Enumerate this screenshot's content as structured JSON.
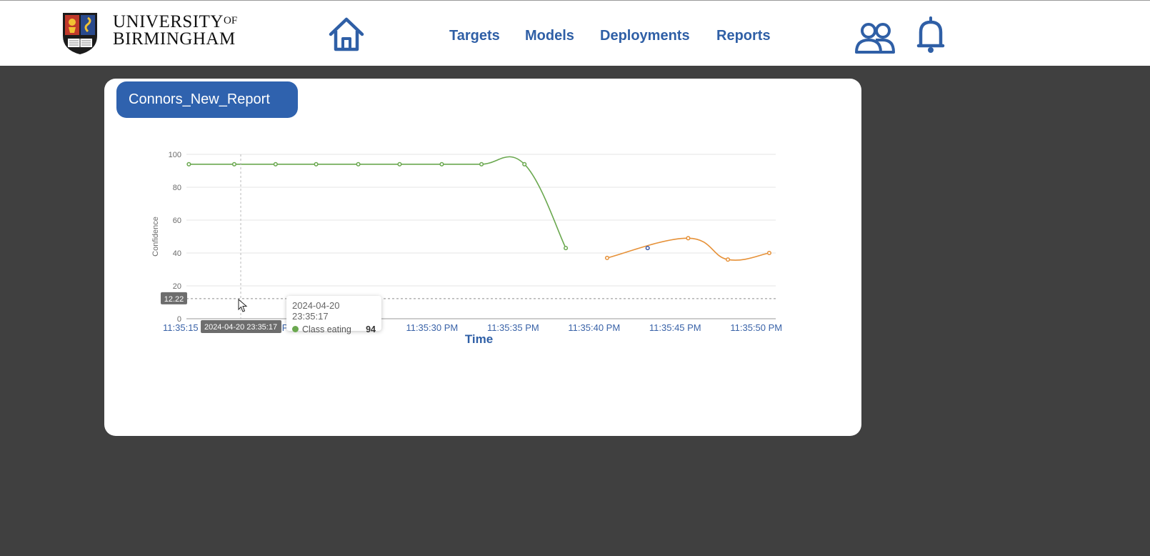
{
  "header": {
    "logo": {
      "line1": "UNIVERSITY",
      "of": "OF",
      "line2": "BIRMINGHAM"
    },
    "home_icon": "home-icon",
    "nav": [
      "Targets",
      "Models",
      "Deployments",
      "Reports"
    ],
    "users_icon": "users-icon",
    "bell_icon": "bell-icon",
    "accent_color": "#2f5fa6"
  },
  "report": {
    "title": "Connors_New_Report"
  },
  "chart_data": {
    "type": "line",
    "ylabel": "Confidence",
    "xlabel": "Time",
    "ylim": [
      0,
      100
    ],
    "y_ticks": [
      "0",
      "20",
      "40",
      "60",
      "80",
      "100"
    ],
    "x_ticks": [
      "11:35:15 PM",
      "11:35:20 PM",
      "11:35:25 PM",
      "11:35:30 PM",
      "11:35:35 PM",
      "11:35:40 PM",
      "11:35:45 PM",
      "11:35:50 PM"
    ],
    "x_tick_values": [
      15,
      20,
      25,
      30,
      35,
      40,
      45,
      50
    ],
    "series": [
      {
        "name": "Class eating",
        "color": "#6aa84f",
        "x": [
          15.0,
          17.8,
          20.35,
          22.85,
          25.45,
          28.0,
          30.6,
          33.05,
          35.7,
          38.25
        ],
        "y": [
          94,
          94,
          94,
          94,
          94,
          94,
          94,
          94,
          94,
          43
        ]
      },
      {
        "color": "#e69138",
        "x": [
          40.8,
          45.8,
          48.25,
          50.8
        ],
        "y": [
          37,
          49,
          36,
          40
        ]
      },
      {
        "color": "#3c5aa8",
        "x": [
          43.3
        ],
        "y": [
          43
        ]
      }
    ],
    "grid": true,
    "crosshair": {
      "y_label": "12.22",
      "x_label": "2024-04-20 23:35:17"
    },
    "tooltip": {
      "title": "2024-04-20 23:35:17",
      "series": "Class eating",
      "value": "94"
    }
  }
}
